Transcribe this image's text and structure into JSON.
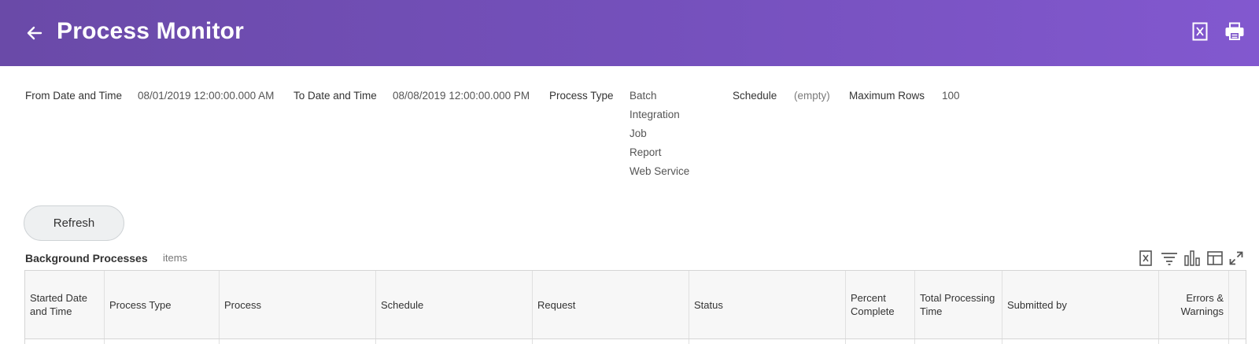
{
  "header": {
    "title": "Process Monitor",
    "back_icon": "arrow-left-icon",
    "export_icon": "excel-export-icon",
    "print_icon": "printer-icon",
    "background_color": "#7450bb"
  },
  "params": {
    "from": {
      "label": "From Date and Time",
      "value": "08/01/2019 12:00:00.000 AM"
    },
    "to": {
      "label": "To Date and Time",
      "value": "08/08/2019 12:00:00.000 PM"
    },
    "process_type": {
      "label": "Process Type",
      "values": [
        "Batch",
        "Integration",
        "Job",
        "Report",
        "Web Service"
      ]
    },
    "schedule": {
      "label": "Schedule",
      "value": "(empty)"
    },
    "max_rows": {
      "label": "Maximum Rows",
      "value": "100"
    }
  },
  "actions": {
    "refresh_label": "Refresh"
  },
  "grid": {
    "title": "Background Processes",
    "count_label": "items",
    "toolbar": [
      "excel-export-icon",
      "filter-icon",
      "chart-icon",
      "column-layout-icon",
      "fullscreen-icon"
    ],
    "columns": [
      "Started Date and Time",
      "Process Type",
      "Process",
      "Schedule",
      "Request",
      "Status",
      "Percent Complete",
      "Total Processing Time",
      "Submitted by",
      "Errors & Warnings"
    ]
  }
}
